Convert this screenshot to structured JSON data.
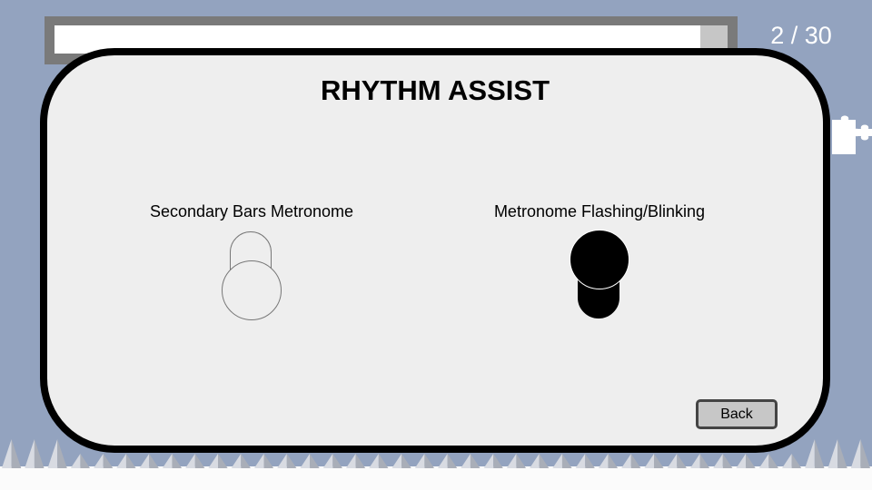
{
  "progress": {
    "fraction": 0.96
  },
  "level_counter": "2 / 30",
  "icons": {
    "puzzle": "puzzle-piece-icon",
    "spikes": "spike-row"
  },
  "colors": {
    "background": "#93a3bf",
    "panel": "#eeeeee",
    "panel_border": "#000000",
    "progress_track": "#7a7a7a",
    "progress_fill": "#ffffff",
    "toggle_on": "#000000",
    "toggle_off": "#eeeeee",
    "button": "#c7c7c7"
  },
  "dialog": {
    "title": "RHYTHM ASSIST",
    "options": [
      {
        "label": "Secondary Bars Metronome",
        "enabled": false
      },
      {
        "label": "Metronome Flashing/Blinking",
        "enabled": true
      }
    ],
    "back_label": "Back"
  }
}
